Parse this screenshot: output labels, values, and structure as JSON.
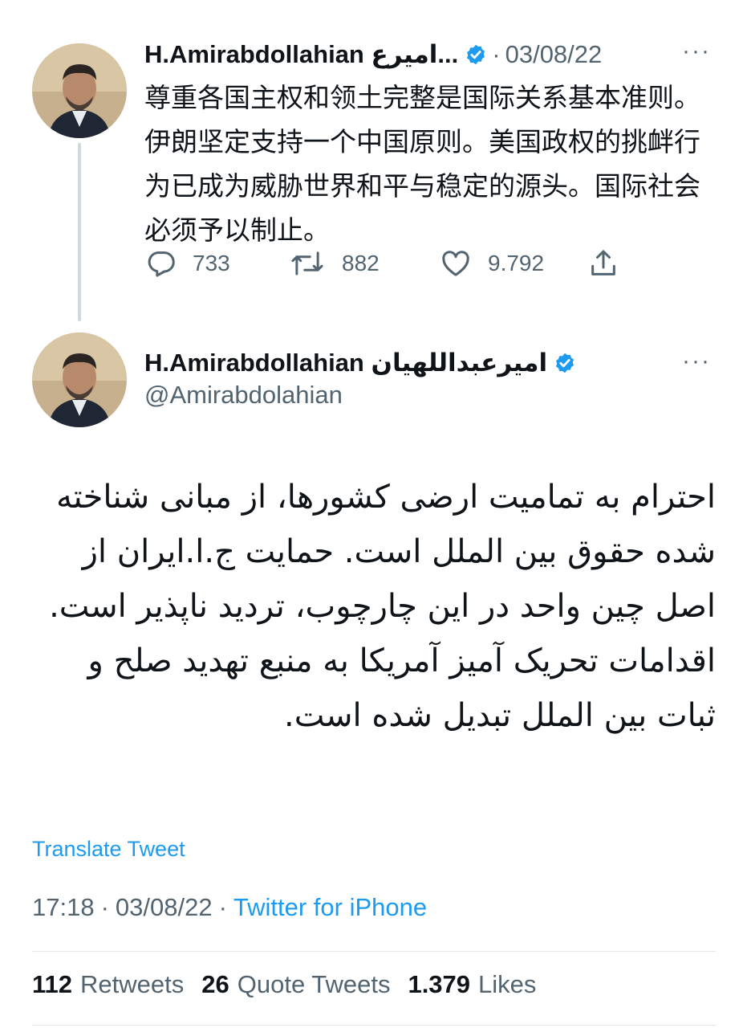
{
  "reply_tweet": {
    "display_name": "H.Amirabdollahian امیرع...",
    "date": "03/08/22",
    "separator": "·",
    "more_label": "···",
    "text": "尊重各国主权和领土完整是国际关系基本准则。伊朗坚定支持一个中国原则。美国政权的挑衅行为已成为威胁世界和平与稳定的源头。国际社会必须予以制止。",
    "actions": {
      "replies": "733",
      "retweets": "882",
      "likes": "9.792"
    },
    "icons": {
      "reply": "reply-icon",
      "retweet": "retweet-icon",
      "like": "heart-icon",
      "share": "share-icon"
    }
  },
  "main_tweet": {
    "display_name": "H.Amirabdollahian امیرعبداللهیان",
    "handle": "@Amirabdolahian",
    "more_label": "···",
    "text": "احترام به تمامیت ارضی کشورها، از مبانی شناخته شده حقوق بین الملل است. حمایت ج.ا.ایران از اصل چین واحد در این چارچوب، تردید ناپذیر است. اقدامات تحریک آمیز آمریکا به منبع تهدید صلح و ثبات بین الملل تبدیل شده است.",
    "translate_label": "Translate Tweet",
    "time": "17:18",
    "date": "03/08/22",
    "separator": "·",
    "source": "Twitter for iPhone",
    "stats": {
      "retweets_count": "112",
      "retweets_label": "Retweets",
      "quotes_count": "26",
      "quotes_label": "Quote Tweets",
      "likes_count": "1.379",
      "likes_label": "Likes"
    }
  },
  "colors": {
    "accent": "#1d9bf0",
    "muted": "#536471",
    "text": "#0f1419",
    "divider": "#e1e8ed"
  }
}
